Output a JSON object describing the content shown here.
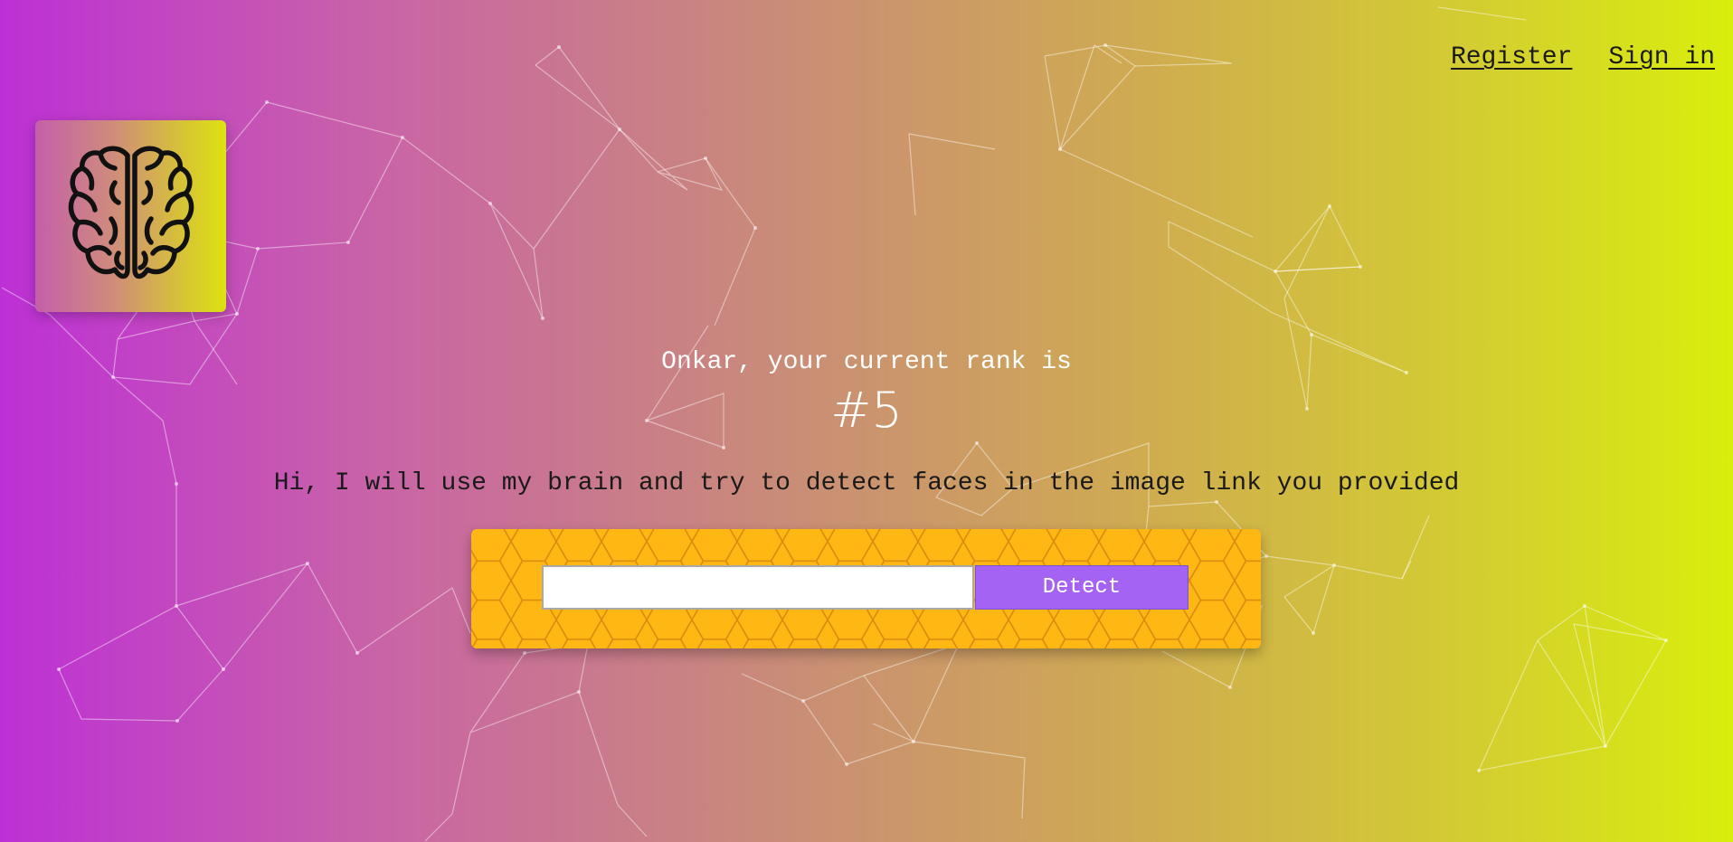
{
  "nav": {
    "register_label": "Register",
    "signin_label": "Sign in"
  },
  "logo": {
    "icon": "brain-icon"
  },
  "rank": {
    "message": "Onkar, your current rank is",
    "value": "#5"
  },
  "intro": {
    "text": "Hi, I will use my brain and try to detect faces in the image link you provided"
  },
  "form": {
    "input_value": "",
    "button_label": "Detect"
  },
  "colors": {
    "gradient_start": "#bd30d6",
    "gradient_end": "#d9ee0c",
    "panel": "#ffb714",
    "button": "#a463f2"
  }
}
